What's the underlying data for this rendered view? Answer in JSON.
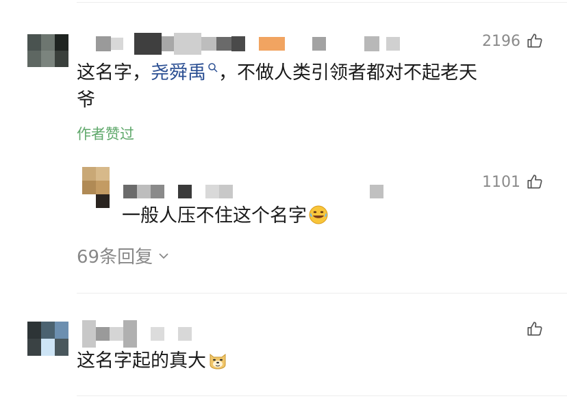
{
  "comments": [
    {
      "likes": "2196",
      "text_before": "这名字，",
      "link": "尧舜禹",
      "text_after": "，不做人类引领者都对不起老天",
      "text_line2": "爷",
      "author_liked": "作者赞过"
    },
    {
      "likes": "",
      "text": "这名字起的真大"
    }
  ],
  "reply": {
    "likes": "1101",
    "text": "一般人压不住这个名字"
  },
  "more_replies": "69条回复",
  "icons": {
    "like": "thumbs-up-icon",
    "link_search": "search-icon",
    "reply_emoji": "laugh-cry-emoji-icon",
    "comment2_emoji": "doge-emoji-icon",
    "expand": "chevron-down-icon"
  },
  "colors": {
    "link": "#2b4f93",
    "author_liked": "#5fa86b",
    "meta": "#888888"
  }
}
